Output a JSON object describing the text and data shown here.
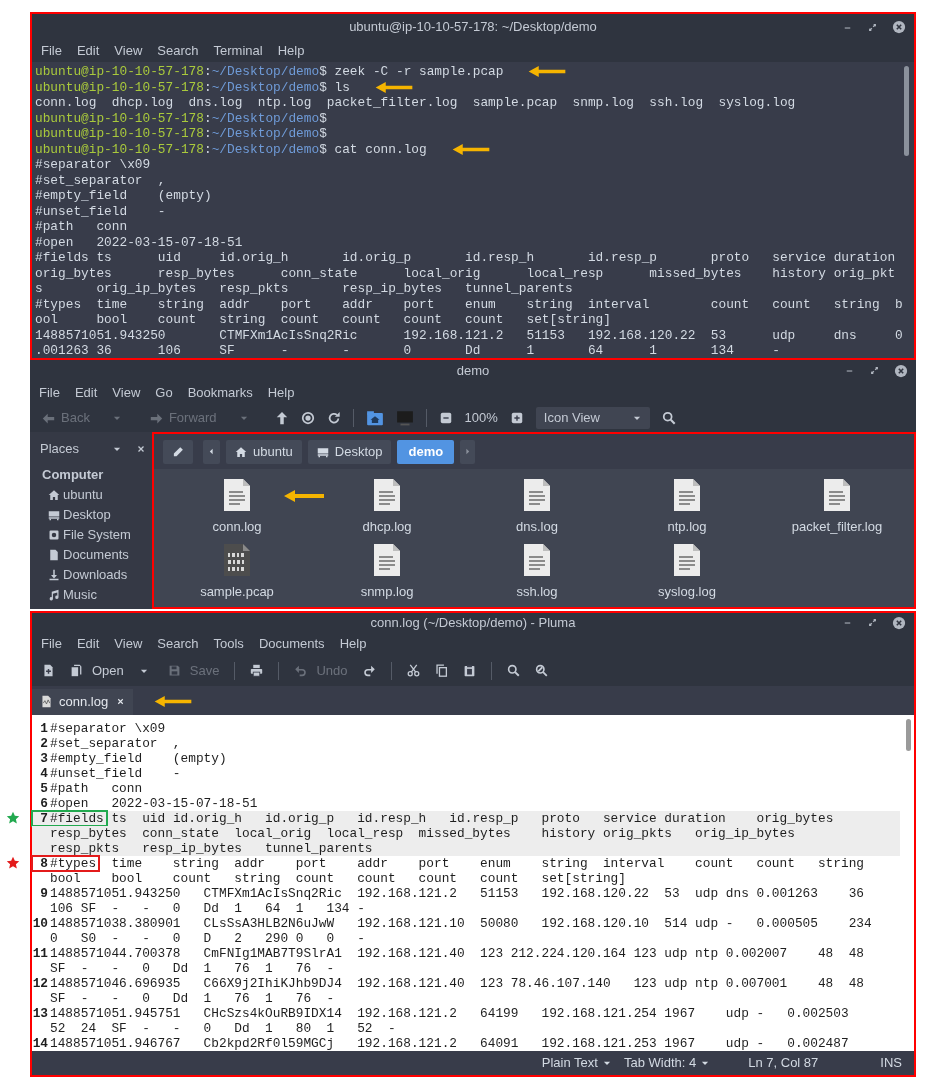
{
  "terminal": {
    "title": "ubuntu@ip-10-10-57-178: ~/Desktop/demo",
    "menu": [
      "File",
      "Edit",
      "View",
      "Search",
      "Terminal",
      "Help"
    ],
    "lines": [
      {
        "kind": "prompt",
        "user": "ubuntu@ip-10-10-57-178",
        "separator": ":",
        "path": "~/Desktop/demo",
        "command": "$ zeek -C -r sample.pcap",
        "arrow": true
      },
      {
        "kind": "prompt",
        "user": "ubuntu@ip-10-10-57-178",
        "separator": ":",
        "path": "~/Desktop/demo",
        "command": "$ ls",
        "arrow": true
      },
      {
        "kind": "output",
        "text": "conn.log  dhcp.log  dns.log  ntp.log  packet_filter.log  sample.pcap  snmp.log  ssh.log  syslog.log",
        "arrow": false
      },
      {
        "kind": "prompt",
        "user": "ubuntu@ip-10-10-57-178",
        "separator": ":",
        "path": "~/Desktop/demo",
        "command": "$",
        "arrow": false
      },
      {
        "kind": "prompt",
        "user": "ubuntu@ip-10-10-57-178",
        "separator": ":",
        "path": "~/Desktop/demo",
        "command": "$",
        "arrow": false
      },
      {
        "kind": "prompt",
        "user": "ubuntu@ip-10-10-57-178",
        "separator": ":",
        "path": "~/Desktop/demo",
        "command": "$ cat conn.log",
        "arrow": true
      },
      {
        "kind": "output",
        "text": "#separator \\x09",
        "arrow": false
      },
      {
        "kind": "output",
        "text": "#set_separator  ,",
        "arrow": false
      },
      {
        "kind": "output",
        "text": "#empty_field    (empty)",
        "arrow": false
      },
      {
        "kind": "output",
        "text": "#unset_field    -",
        "arrow": false
      },
      {
        "kind": "output",
        "text": "#path   conn",
        "arrow": false
      },
      {
        "kind": "output",
        "text": "#open   2022-03-15-07-18-51",
        "arrow": false
      },
      {
        "kind": "output",
        "text": "#fields ts      uid     id.orig_h       id.orig_p       id.resp_h       id.resp_p       proto   service duration",
        "arrow": false
      },
      {
        "kind": "output",
        "text": "orig_bytes      resp_bytes      conn_state      local_orig      local_resp      missed_bytes    history orig_pkt",
        "arrow": false
      },
      {
        "kind": "output",
        "text": "s       orig_ip_bytes   resp_pkts       resp_ip_bytes   tunnel_parents",
        "arrow": false
      },
      {
        "kind": "output",
        "text": "#types  time    string  addr    port    addr    port    enum    string  interval        count   count   string  b",
        "arrow": false
      },
      {
        "kind": "output",
        "text": "ool     bool    count   string  count   count   count   count   set[string]",
        "arrow": false
      },
      {
        "kind": "output",
        "text": "1488571051.943250       CTMFXm1AcIsSnq2Ric      192.168.121.2   51153   192.168.120.22  53      udp     dns     0",
        "arrow": false
      },
      {
        "kind": "output",
        "text": ".001263 36      106     SF      -       -       0       Dd      1       64      1       134     -",
        "arrow": false
      }
    ]
  },
  "file_manager": {
    "title": "demo",
    "menu": [
      "File",
      "Edit",
      "View",
      "Go",
      "Bookmarks",
      "Help"
    ],
    "toolbar": [
      {
        "kind": "back",
        "label": "Back",
        "disabled": true
      },
      {
        "kind": "caret",
        "disabled": true
      },
      {
        "kind": "forward",
        "label": "Forward",
        "disabled": true
      },
      {
        "kind": "caret",
        "disabled": true
      },
      {
        "kind": "up",
        "disabled": false
      },
      {
        "kind": "stop",
        "disabled": false
      },
      {
        "kind": "reload",
        "disabled": false
      },
      {
        "kind": "separator"
      },
      {
        "kind": "home_folder",
        "disabled": false
      },
      {
        "kind": "computer",
        "disabled": false
      },
      {
        "kind": "separator"
      },
      {
        "kind": "zoom_out",
        "disabled": false
      },
      {
        "kind": "zoom_level",
        "label": "100%",
        "disabled": false
      },
      {
        "kind": "zoom_in",
        "disabled": false
      },
      {
        "kind": "view",
        "label": "Icon View",
        "disabled": false
      },
      {
        "kind": "search",
        "disabled": false
      }
    ],
    "places": {
      "title": "Places",
      "section": "Computer",
      "items": [
        {
          "label": "ubuntu",
          "kind": "home"
        },
        {
          "label": "Desktop",
          "kind": "desktop"
        },
        {
          "label": "File System",
          "kind": "drive"
        },
        {
          "label": "Documents",
          "kind": "document"
        },
        {
          "label": "Downloads",
          "kind": "download"
        },
        {
          "label": "Music",
          "kind": "music"
        }
      ]
    },
    "path": [
      {
        "label": "ubuntu",
        "kind": "home",
        "selected": false
      },
      {
        "label": "Desktop",
        "kind": "desktop",
        "selected": false
      },
      {
        "label": "demo",
        "kind": "folder",
        "selected": true
      }
    ],
    "files": [
      {
        "name": "conn.log",
        "kind": "text",
        "arrow": true
      },
      {
        "name": "dhcp.log",
        "kind": "text",
        "arrow": false
      },
      {
        "name": "dns.log",
        "kind": "text",
        "arrow": false
      },
      {
        "name": "ntp.log",
        "kind": "text",
        "arrow": false
      },
      {
        "name": "packet_filter.log",
        "kind": "text",
        "arrow": false
      },
      {
        "name": "sample.pcap",
        "kind": "binary",
        "arrow": false
      },
      {
        "name": "snmp.log",
        "kind": "text",
        "arrow": false
      },
      {
        "name": "ssh.log",
        "kind": "text",
        "arrow": false
      },
      {
        "name": "syslog.log",
        "kind": "text",
        "arrow": false
      }
    ]
  },
  "editor": {
    "title": "conn.log (~/Desktop/demo) - Pluma",
    "menu": [
      "File",
      "Edit",
      "View",
      "Search",
      "Tools",
      "Documents",
      "Help"
    ],
    "toolbar": [
      {
        "kind": "new",
        "disabled": false
      },
      {
        "kind": "open",
        "label": "Open",
        "disabled": false
      },
      {
        "kind": "caret",
        "disabled": false
      },
      {
        "kind": "save",
        "label": "Save",
        "disabled": true
      },
      {
        "kind": "separator"
      },
      {
        "kind": "print",
        "disabled": false
      },
      {
        "kind": "separator"
      },
      {
        "kind": "undo",
        "label": "Undo",
        "disabled": true
      },
      {
        "kind": "redo",
        "disabled": false
      },
      {
        "kind": "separator"
      },
      {
        "kind": "cut",
        "disabled": false
      },
      {
        "kind": "copy",
        "disabled": false
      },
      {
        "kind": "paste",
        "disabled": false
      },
      {
        "kind": "separator"
      },
      {
        "kind": "search",
        "disabled": false
      },
      {
        "kind": "replace",
        "disabled": false
      }
    ],
    "tab": {
      "label": "conn.log",
      "arrow": true
    },
    "lines": [
      {
        "number": "1",
        "rows": [
          "#separator \\x09"
        ],
        "current": false
      },
      {
        "number": "2",
        "rows": [
          "#set_separator  ,"
        ],
        "current": false
      },
      {
        "number": "3",
        "rows": [
          "#empty_field    (empty)"
        ],
        "current": false
      },
      {
        "number": "4",
        "rows": [
          "#unset_field    -"
        ],
        "current": false
      },
      {
        "number": "5",
        "rows": [
          "#path   conn"
        ],
        "current": false
      },
      {
        "number": "6",
        "rows": [
          "#open   2022-03-15-07-18-51"
        ],
        "current": false
      },
      {
        "number": "7",
        "rows": [
          "#fields ts  uid id.orig_h   id.orig_p   id.resp_h   id.resp_p   proto   service duration    orig_bytes",
          "resp_bytes  conn_state  local_orig  local_resp  missed_bytes    history orig_pkts   orig_ip_bytes",
          "resp_pkts   resp_ip_bytes   tunnel_parents"
        ],
        "current": true,
        "annotation": {
          "color": "#22a94f"
        }
      },
      {
        "number": "8",
        "rows": [
          "#types  time    string  addr    port    addr    port    enum    string  interval    count   count   string",
          "bool    bool    count   string  count   count   count   count   set[string]"
        ],
        "current": false,
        "annotation": {
          "color": "#e31b1b"
        }
      },
      {
        "number": "9",
        "rows": [
          "1488571051.943250   CTMFXm1AcIsSnq2Ric  192.168.121.2   51153   192.168.120.22  53  udp dns 0.001263    36",
          "106 SF  -   -   0   Dd  1   64  1   134 -"
        ],
        "current": false
      },
      {
        "number": "10",
        "rows": [
          "1488571038.380901   CLsSsA3HLB2N6uJwW   192.168.121.10  50080   192.168.120.10  514 udp -   0.000505    234",
          "0   S0  -   -   0   D   2   290 0   0   -"
        ],
        "current": false
      },
      {
        "number": "11",
        "rows": [
          "1488571044.700378   CmFNIg1MAB7T9SlrA1  192.168.121.40  123 212.224.120.164 123 udp ntp 0.002007    48  48",
          "SF  -   -   0   Dd  1   76  1   76  -"
        ],
        "current": false
      },
      {
        "number": "12",
        "rows": [
          "1488571046.696935   C66X9j2IhiKJhb9DJ4  192.168.121.40  123 78.46.107.140   123 udp ntp 0.007001    48  48",
          "SF  -   -   0   Dd  1   76  1   76  -"
        ],
        "current": false
      },
      {
        "number": "13",
        "rows": [
          "1488571051.945751   CHcSzs4kOuRB9IDX14  192.168.121.2   64199   192.168.121.254 1967    udp -   0.002503",
          "52  24  SF  -   -   0   Dd  1   80  1   52  -"
        ],
        "current": false
      },
      {
        "number": "14",
        "rows": [
          "1488571051.946767   Cb2kpd2Rf0l59MGCj   192.168.121.2   64091   192.168.121.253 1967    udp -   0.002487"
        ],
        "current": false
      }
    ],
    "status": {
      "language": "Plain Text",
      "tab_width": "Tab Width: 4",
      "position": "Ln 7, Col 87",
      "mode": "INS"
    }
  }
}
